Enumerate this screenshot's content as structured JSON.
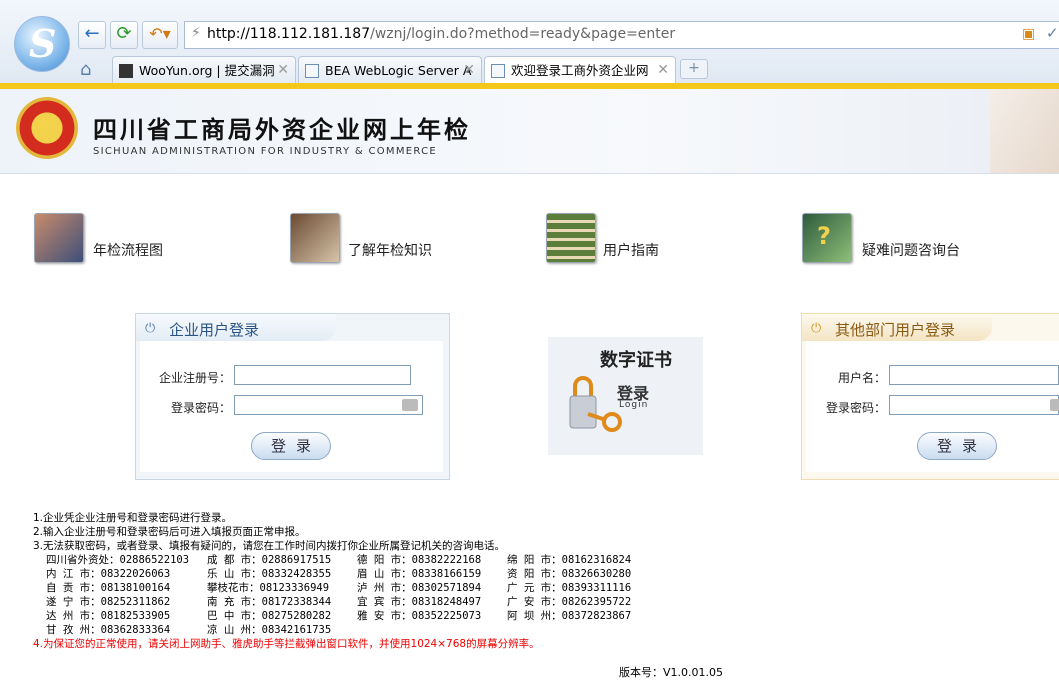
{
  "browser": {
    "url": "http://118.112.181.187/wznj/login.do?method=ready&page=enter",
    "url_host": "http://118.112.181.187",
    "url_path": "/wznj/login.do?method=ready&page=enter",
    "tabs": [
      {
        "label": "WooYun.org | 提交漏洞"
      },
      {
        "label": "BEA WebLogic Server A"
      },
      {
        "label": "欢迎登录工商外资企业网"
      }
    ],
    "new_tab_symbol": "+",
    "close_symbol": "✕"
  },
  "site": {
    "title": "四川省工商局外资企业网上年检",
    "subtitle": "SICHUAN ADMINISTRATION FOR INDUSTRY & COMMERCE"
  },
  "nav": [
    {
      "label": "年检流程图"
    },
    {
      "label": "了解年检知识"
    },
    {
      "label": "用户指南"
    },
    {
      "label": "疑难问题咨询台"
    }
  ],
  "login_enterprise": {
    "title": "企业用户登录",
    "reg_label": "企业注册号：",
    "pwd_label": "登录密码：",
    "reg_value": "",
    "pwd_value": "",
    "button": "登录"
  },
  "cert": {
    "title": "数字证书",
    "login_cn": "登录",
    "login_en": "Login"
  },
  "login_other": {
    "title": "其他部门用户登录",
    "user_label": "用户名：",
    "pwd_label": "登录密码：",
    "user_value": "",
    "pwd_value": "",
    "button": "登录"
  },
  "notes": [
    "1.企业凭企业注册号和登录密码进行登录。",
    "2.输入企业注册号和登录密码后可进入填报页面正常申报。",
    "3.无法获取密码，或者登录、填报有疑问的，请您在工作时间内拨打你企业所属登记机关的咨询电话。"
  ],
  "phones": [
    [
      "四川省外资处：02886522103",
      "成 都 市：02886917515",
      "德 阳 市：08382222168",
      "绵 阳 市：08162316824"
    ],
    [
      "内 江 市：08322026063",
      "乐 山 市：08332428355",
      "眉 山 市：08338166159",
      "资 阳 市：08326630280"
    ],
    [
      "自 贡 市：08138100164",
      "攀枝花市：08123336949",
      "泸 州 市：08302571894",
      "广 元 市：08393311116"
    ],
    [
      "遂 宁 市：08252311862",
      "南 充 市：08172338344",
      "宜 宾 市：08318248497",
      "广 安 市：08262395722"
    ],
    [
      "达 州 市：08182533905",
      "巴 中 市：08275280282",
      "雅 安 市：08352225073",
      "阿 坝 州：08372823867"
    ],
    [
      "甘 孜 州：08362833364",
      "凉 山 州：08342161735"
    ]
  ],
  "warning": "4.为保证您的正常使用，请关闭上网助手、雅虎助手等拦截弹出窗口软件，并使用1024×768的屏幕分辨率。",
  "version": "版本号：V1.0.01.05"
}
